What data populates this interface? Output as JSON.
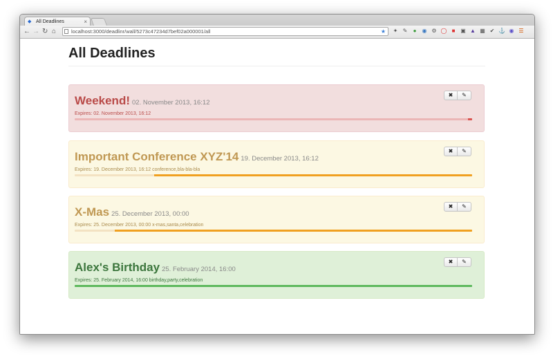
{
  "browser": {
    "tab_title": "All Deadlines",
    "url": "localhost:3000/deadlinr/wall/5273c47234d7bef02a000001/all"
  },
  "page": {
    "title": "All Deadlines"
  },
  "deadlines": [
    {
      "name": "Weekend!",
      "date": "02. November 2013, 16:12",
      "meta": "Expires: 02. November 2013, 16:12",
      "remaining": 0.01,
      "status": "red"
    },
    {
      "name": "Important Conference XYZ'14",
      "date": "19. December 2013, 16:12",
      "meta": "Expires: 19. December 2013, 16:12 conference,bla-bla-bla",
      "remaining": 0.8,
      "status": "yellow"
    },
    {
      "name": "X-Mas",
      "date": "25. December 2013, 00:00",
      "meta": "Expires: 25. December 2013, 00:00 x-mas,santa,celebration",
      "remaining": 0.9,
      "status": "yellow"
    },
    {
      "name": "Alex's Birthday",
      "date": "25. February 2014, 16:00",
      "meta": "Expires: 25. February 2014, 16:00 birthday,party,celebration",
      "remaining": 1.0,
      "status": "green"
    }
  ],
  "colors": {
    "danger": "#d9534f",
    "warning": "#f0a020",
    "success": "#5cb85c"
  }
}
